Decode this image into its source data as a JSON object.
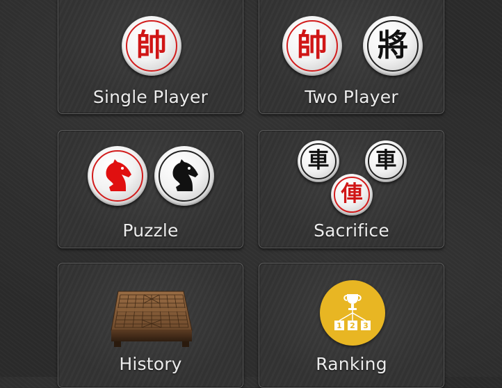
{
  "menu": {
    "single_player": {
      "label": "Single Player",
      "piece": "帥"
    },
    "two_player": {
      "label": "Two Player",
      "pieces": [
        "帥",
        "將"
      ]
    },
    "puzzle": {
      "label": "Puzzle"
    },
    "sacrifice": {
      "label": "Sacrifice",
      "pieces": [
        "車",
        "車",
        "俥"
      ]
    },
    "history": {
      "label": "History"
    },
    "ranking": {
      "label": "Ranking",
      "podium": [
        "1",
        "2",
        "3"
      ]
    }
  },
  "colors": {
    "red_piece": "#d01616",
    "black_piece": "#111111",
    "ranking_badge": "#e8b623",
    "label_text": "#ececec"
  },
  "icons": {
    "puzzle": [
      "red-horse-icon",
      "black-horse-icon"
    ],
    "history": "xiangqi-board-icon",
    "ranking": "trophy-podium-icon"
  }
}
